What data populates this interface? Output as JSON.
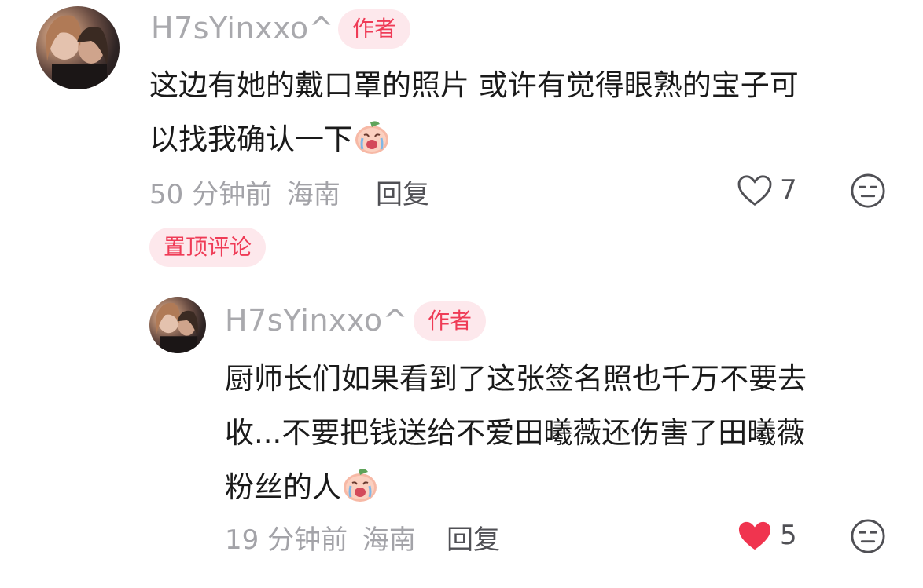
{
  "comments": [
    {
      "username": "H7sYinxxo^",
      "badge": "作者",
      "lines": [
        "这边有她的戴口罩的照片 或许有觉得眼熟的宝子可",
        "以找我确认一下"
      ],
      "emoji": "crying-peach-emoji",
      "time": "50 分钟前",
      "location": "海南",
      "reply_label": "回复",
      "likes": "7",
      "liked": false,
      "pinned_label": "置顶评论"
    },
    {
      "username": "H7sYinxxo^",
      "badge": "作者",
      "lines": [
        "厨师长们如果看到了这张签名照也千万不要去",
        "收...不要把钱送给不爱田曦薇还伤害了田曦薇",
        "粉丝的人"
      ],
      "emoji": "crying-peach-emoji",
      "time": "19 分钟前",
      "location": "海南",
      "reply_label": "回复",
      "likes": "5",
      "liked": true
    }
  ],
  "colors": {
    "accent_red": "#ef3b56",
    "badge_bg": "#fde8ec",
    "meta_gray": "#a3a3a8",
    "heart_liked": "#f0344f"
  }
}
